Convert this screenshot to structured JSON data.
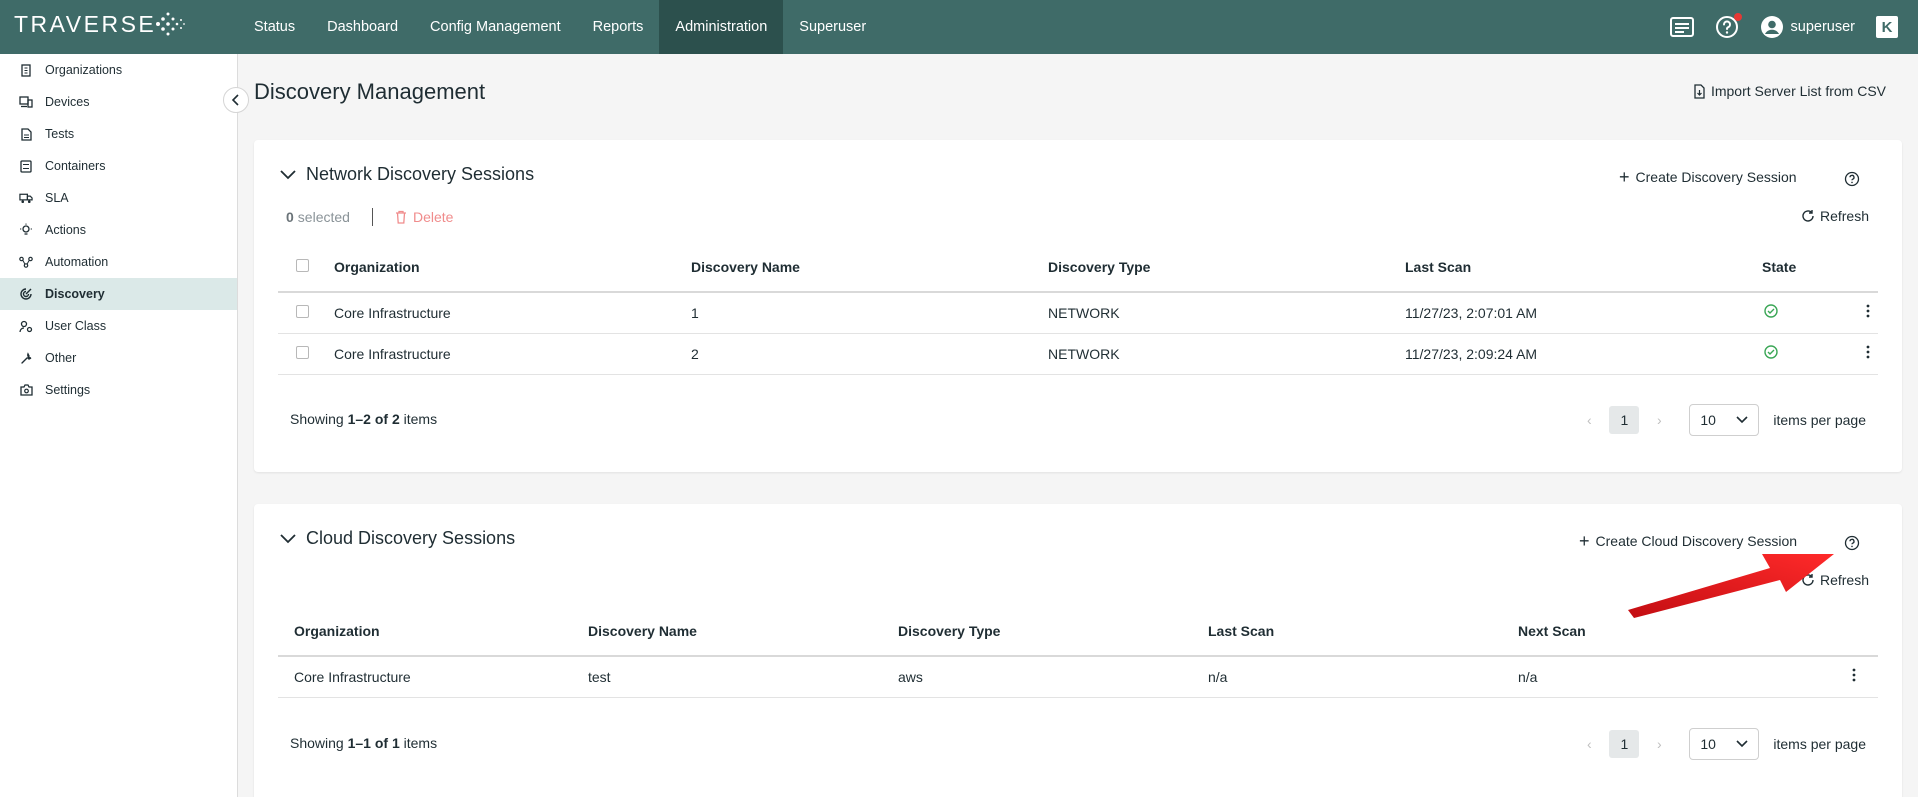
{
  "app": {
    "logo": "TRAVERSE"
  },
  "nav": [
    {
      "label": "Status"
    },
    {
      "label": "Dashboard"
    },
    {
      "label": "Config Management"
    },
    {
      "label": "Reports"
    },
    {
      "label": "Administration",
      "active": true
    },
    {
      "label": "Superuser"
    }
  ],
  "user": {
    "name": "superuser",
    "badge": "K"
  },
  "sidebar": {
    "items": [
      {
        "label": "Organizations",
        "icon": "building-icon"
      },
      {
        "label": "Devices",
        "icon": "devices-icon"
      },
      {
        "label": "Tests",
        "icon": "document-icon"
      },
      {
        "label": "Containers",
        "icon": "container-icon"
      },
      {
        "label": "SLA",
        "icon": "truck-icon"
      },
      {
        "label": "Actions",
        "icon": "bulb-icon"
      },
      {
        "label": "Automation",
        "icon": "automation-icon"
      },
      {
        "label": "Discovery",
        "icon": "radar-icon",
        "active": true
      },
      {
        "label": "User Class",
        "icon": "user-cog-icon"
      },
      {
        "label": "Other",
        "icon": "wrench-icon"
      },
      {
        "label": "Settings",
        "icon": "settings-icon"
      }
    ]
  },
  "page": {
    "title": "Discovery Management",
    "import_label": "Import Server List from CSV"
  },
  "network": {
    "title": "Network Discovery Sessions",
    "create_label": "Create Discovery Session",
    "refresh_label": "Refresh",
    "selected_count": "0",
    "selected_text": "selected",
    "delete_label": "Delete",
    "columns": [
      "Organization",
      "Discovery Name",
      "Discovery Type",
      "Last Scan",
      "State"
    ],
    "rows": [
      {
        "organization": "Core Infrastructure",
        "name": "1",
        "type": "NETWORK",
        "last_scan": "11/27/23, 2:07:01 AM",
        "state": "ok"
      },
      {
        "organization": "Core Infrastructure",
        "name": "2",
        "type": "NETWORK",
        "last_scan": "11/27/23, 2:09:24 AM",
        "state": "ok"
      }
    ],
    "footer": {
      "prefix": "Showing",
      "range": "1–2",
      "of": "of",
      "total": "2",
      "suffix": "items"
    },
    "page": "1",
    "page_size": "10",
    "per_page_label": "items per page"
  },
  "cloud": {
    "title": "Cloud Discovery Sessions",
    "create_label": "Create Cloud Discovery Session",
    "refresh_label": "Refresh",
    "columns": [
      "Organization",
      "Discovery Name",
      "Discovery Type",
      "Last Scan",
      "Next Scan"
    ],
    "rows": [
      {
        "organization": "Core Infrastructure",
        "name": "test",
        "type": "aws",
        "last_scan": "n/a",
        "next_scan": "n/a"
      }
    ],
    "footer": {
      "prefix": "Showing",
      "range": "1–1",
      "of": "of",
      "total": "1",
      "suffix": "items"
    },
    "page": "1",
    "page_size": "10",
    "per_page_label": "items per page"
  },
  "colors": {
    "topbar": "#3f6b68",
    "active_nav": "#2c504d",
    "sidebar_active": "#dbe9e8",
    "success": "#3aa655",
    "delete": "#f08c8c",
    "annotation": "#e8141a"
  }
}
